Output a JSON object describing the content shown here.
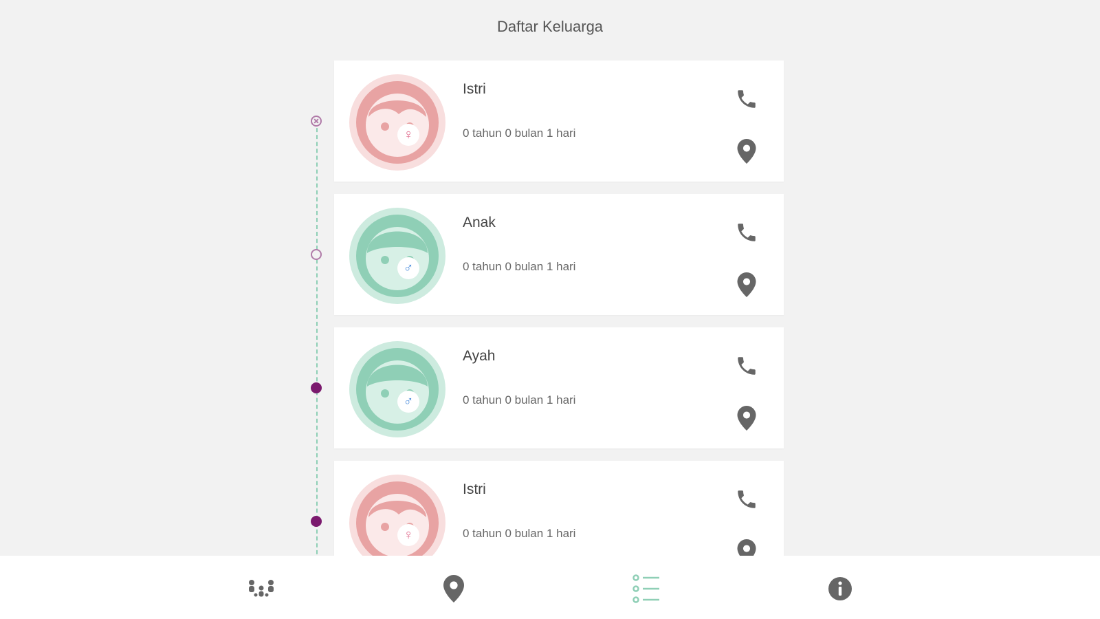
{
  "header": {
    "title": "Daftar Keluarga"
  },
  "members": [
    {
      "name": "Istri",
      "age": "0 tahun 0 bulan 1 hari",
      "gender": "female",
      "avatar_color": "#e8a3a3"
    },
    {
      "name": "Anak",
      "age": "0 tahun 0 bulan 1 hari",
      "gender": "male",
      "avatar_color": "#8fcfb6"
    },
    {
      "name": "Ayah",
      "age": "0 tahun 0 bulan 1 hari",
      "gender": "male",
      "avatar_color": "#8fcfb6"
    },
    {
      "name": "Istri",
      "age": "0 tahun 0 bulan 1 hari",
      "gender": "female",
      "avatar_color": "#e8a3a3"
    }
  ],
  "gender_symbols": {
    "female": "♀",
    "male": "♂"
  },
  "timeline_nodes": [
    "ring-x",
    "ring",
    "filled",
    "filled"
  ],
  "bottom_nav": {
    "items": [
      "family-icon",
      "location-pin-icon",
      "list-icon",
      "info-icon"
    ],
    "active": "list-icon"
  },
  "colors": {
    "accent_green": "#8fcfb6",
    "female_pink": "#e8a3a3",
    "timeline_purple": "#7b1a6e",
    "icon_gray": "#666666"
  }
}
